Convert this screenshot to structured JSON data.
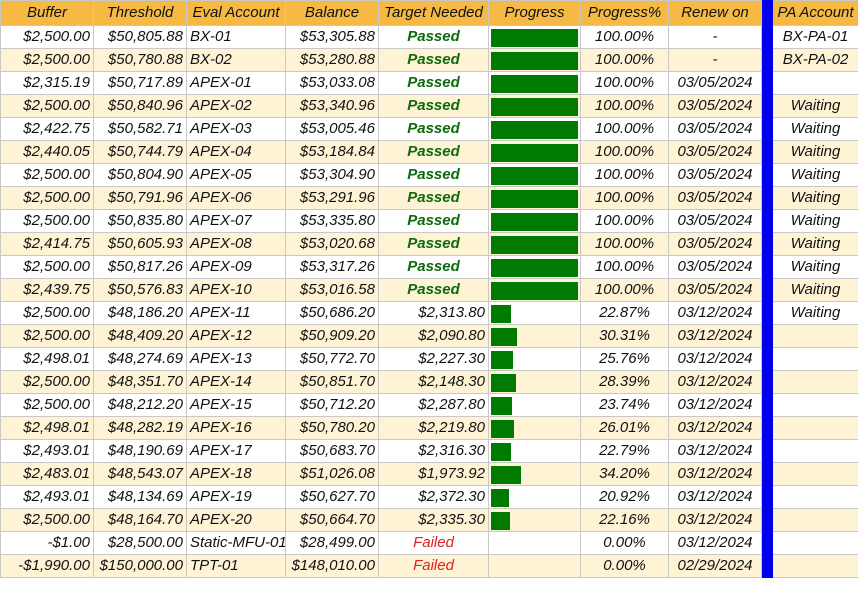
{
  "headers": {
    "buffer": "Buffer",
    "threshold": "Threshold",
    "eval_account": "Eval Account",
    "balance": "Balance",
    "target_needed": "Target Needed",
    "progress": "Progress",
    "progress_pct": "Progress%",
    "renew_on": "Renew on",
    "pa_account": "PA Account"
  },
  "colors": {
    "header_bg": "#f6b943",
    "row_alt_bg": "#fff3d6",
    "progress_bar": "#007a00",
    "passed_text": "#0c6b0c",
    "failed_text": "#e02020",
    "separator": "#0000ee"
  },
  "rows": [
    {
      "buffer": "$2,500.00",
      "threshold": "$50,805.88",
      "eval": "BX-01",
      "balance": "$53,305.88",
      "target": "Passed",
      "status": "passed",
      "progress": 1.0,
      "pct": "100.00%",
      "renew": "-",
      "pa": "BX-PA-01"
    },
    {
      "buffer": "$2,500.00",
      "threshold": "$50,780.88",
      "eval": "BX-02",
      "balance": "$53,280.88",
      "target": "Passed",
      "status": "passed",
      "progress": 1.0,
      "pct": "100.00%",
      "renew": "-",
      "pa": "BX-PA-02"
    },
    {
      "buffer": "$2,315.19",
      "threshold": "$50,717.89",
      "eval": "APEX-01",
      "balance": "$53,033.08",
      "target": "Passed",
      "status": "passed",
      "progress": 1.0,
      "pct": "100.00%",
      "renew": "03/05/2024",
      "pa": ""
    },
    {
      "buffer": "$2,500.00",
      "threshold": "$50,840.96",
      "eval": "APEX-02",
      "balance": "$53,340.96",
      "target": "Passed",
      "status": "passed",
      "progress": 1.0,
      "pct": "100.00%",
      "renew": "03/05/2024",
      "pa": "Waiting"
    },
    {
      "buffer": "$2,422.75",
      "threshold": "$50,582.71",
      "eval": "APEX-03",
      "balance": "$53,005.46",
      "target": "Passed",
      "status": "passed",
      "progress": 1.0,
      "pct": "100.00%",
      "renew": "03/05/2024",
      "pa": "Waiting"
    },
    {
      "buffer": "$2,440.05",
      "threshold": "$50,744.79",
      "eval": "APEX-04",
      "balance": "$53,184.84",
      "target": "Passed",
      "status": "passed",
      "progress": 1.0,
      "pct": "100.00%",
      "renew": "03/05/2024",
      "pa": "Waiting"
    },
    {
      "buffer": "$2,500.00",
      "threshold": "$50,804.90",
      "eval": "APEX-05",
      "balance": "$53,304.90",
      "target": "Passed",
      "status": "passed",
      "progress": 1.0,
      "pct": "100.00%",
      "renew": "03/05/2024",
      "pa": "Waiting"
    },
    {
      "buffer": "$2,500.00",
      "threshold": "$50,791.96",
      "eval": "APEX-06",
      "balance": "$53,291.96",
      "target": "Passed",
      "status": "passed",
      "progress": 1.0,
      "pct": "100.00%",
      "renew": "03/05/2024",
      "pa": "Waiting"
    },
    {
      "buffer": "$2,500.00",
      "threshold": "$50,835.80",
      "eval": "APEX-07",
      "balance": "$53,335.80",
      "target": "Passed",
      "status": "passed",
      "progress": 1.0,
      "pct": "100.00%",
      "renew": "03/05/2024",
      "pa": "Waiting"
    },
    {
      "buffer": "$2,414.75",
      "threshold": "$50,605.93",
      "eval": "APEX-08",
      "balance": "$53,020.68",
      "target": "Passed",
      "status": "passed",
      "progress": 1.0,
      "pct": "100.00%",
      "renew": "03/05/2024",
      "pa": "Waiting"
    },
    {
      "buffer": "$2,500.00",
      "threshold": "$50,817.26",
      "eval": "APEX-09",
      "balance": "$53,317.26",
      "target": "Passed",
      "status": "passed",
      "progress": 1.0,
      "pct": "100.00%",
      "renew": "03/05/2024",
      "pa": "Waiting"
    },
    {
      "buffer": "$2,439.75",
      "threshold": "$50,576.83",
      "eval": "APEX-10",
      "balance": "$53,016.58",
      "target": "Passed",
      "status": "passed",
      "progress": 1.0,
      "pct": "100.00%",
      "renew": "03/05/2024",
      "pa": "Waiting"
    },
    {
      "buffer": "$2,500.00",
      "threshold": "$48,186.20",
      "eval": "APEX-11",
      "balance": "$50,686.20",
      "target": "$2,313.80",
      "status": "amount",
      "progress": 0.2287,
      "pct": "22.87%",
      "renew": "03/12/2024",
      "pa": "Waiting"
    },
    {
      "buffer": "$2,500.00",
      "threshold": "$48,409.20",
      "eval": "APEX-12",
      "balance": "$50,909.20",
      "target": "$2,090.80",
      "status": "amount",
      "progress": 0.3031,
      "pct": "30.31%",
      "renew": "03/12/2024",
      "pa": ""
    },
    {
      "buffer": "$2,498.01",
      "threshold": "$48,274.69",
      "eval": "APEX-13",
      "balance": "$50,772.70",
      "target": "$2,227.30",
      "status": "amount",
      "progress": 0.2576,
      "pct": "25.76%",
      "renew": "03/12/2024",
      "pa": ""
    },
    {
      "buffer": "$2,500.00",
      "threshold": "$48,351.70",
      "eval": "APEX-14",
      "balance": "$50,851.70",
      "target": "$2,148.30",
      "status": "amount",
      "progress": 0.2839,
      "pct": "28.39%",
      "renew": "03/12/2024",
      "pa": ""
    },
    {
      "buffer": "$2,500.00",
      "threshold": "$48,212.20",
      "eval": "APEX-15",
      "balance": "$50,712.20",
      "target": "$2,287.80",
      "status": "amount",
      "progress": 0.2374,
      "pct": "23.74%",
      "renew": "03/12/2024",
      "pa": ""
    },
    {
      "buffer": "$2,498.01",
      "threshold": "$48,282.19",
      "eval": "APEX-16",
      "balance": "$50,780.20",
      "target": "$2,219.80",
      "status": "amount",
      "progress": 0.2601,
      "pct": "26.01%",
      "renew": "03/12/2024",
      "pa": ""
    },
    {
      "buffer": "$2,493.01",
      "threshold": "$48,190.69",
      "eval": "APEX-17",
      "balance": "$50,683.70",
      "target": "$2,316.30",
      "status": "amount",
      "progress": 0.2279,
      "pct": "22.79%",
      "renew": "03/12/2024",
      "pa": ""
    },
    {
      "buffer": "$2,483.01",
      "threshold": "$48,543.07",
      "eval": "APEX-18",
      "balance": "$51,026.08",
      "target": "$1,973.92",
      "status": "amount",
      "progress": 0.342,
      "pct": "34.20%",
      "renew": "03/12/2024",
      "pa": ""
    },
    {
      "buffer": "$2,493.01",
      "threshold": "$48,134.69",
      "eval": "APEX-19",
      "balance": "$50,627.70",
      "target": "$2,372.30",
      "status": "amount",
      "progress": 0.2092,
      "pct": "20.92%",
      "renew": "03/12/2024",
      "pa": ""
    },
    {
      "buffer": "$2,500.00",
      "threshold": "$48,164.70",
      "eval": "APEX-20",
      "balance": "$50,664.70",
      "target": "$2,335.30",
      "status": "amount",
      "progress": 0.2216,
      "pct": "22.16%",
      "renew": "03/12/2024",
      "pa": ""
    },
    {
      "buffer": "-$1.00",
      "threshold": "$28,500.00",
      "eval": "Static-MFU-01",
      "balance": "$28,499.00",
      "target": "Failed",
      "status": "failed",
      "progress": 0.0,
      "pct": "0.00%",
      "renew": "03/12/2024",
      "pa": ""
    },
    {
      "buffer": "-$1,990.00",
      "threshold": "$150,000.00",
      "eval": "TPT-01",
      "balance": "$148,010.00",
      "target": "Failed",
      "status": "failed",
      "progress": 0.0,
      "pct": "0.00%",
      "renew": "02/29/2024",
      "pa": ""
    }
  ]
}
